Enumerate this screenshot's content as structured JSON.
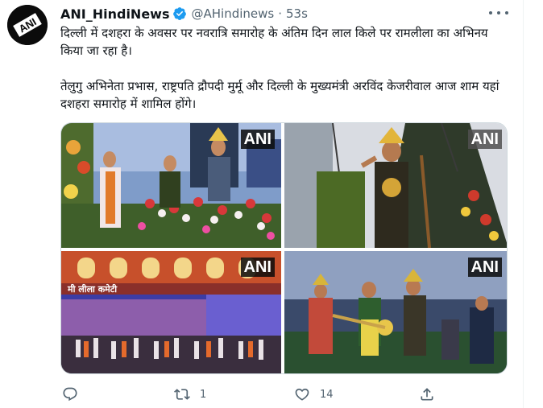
{
  "tweet": {
    "display_name": "ANI_HindiNews",
    "handle": "@AHindinews",
    "separator": "·",
    "time": "53s",
    "avatar_text": "ANI",
    "paragraphs": [
      "दिल्ली में दशहरा के अवसर पर नवरात्रि समारोह के अंतिम दिन लाल किले पर रामलीला का अभिनय किया जा रहा है।",
      "तेलुगु अभिनेता प्रभास, राष्ट्रपति द्रौपदी मुर्मू और दिल्ली के मुख्यमंत्री अरविंद केजरीवाल आज शाम यहां दशहरा समारोह में शामिल होंगे।"
    ]
  },
  "media": {
    "watermarks": [
      "ANI",
      "ANI",
      "ANI",
      "ANI"
    ],
    "stage_banner": "मी लीला कमेटी"
  },
  "actions": {
    "reply_count": "",
    "retweet_count": "1",
    "like_count": "14"
  },
  "colors": {
    "verified": "#1d9bf0",
    "secondary_text": "#536471",
    "primary_text": "#0f1419"
  }
}
